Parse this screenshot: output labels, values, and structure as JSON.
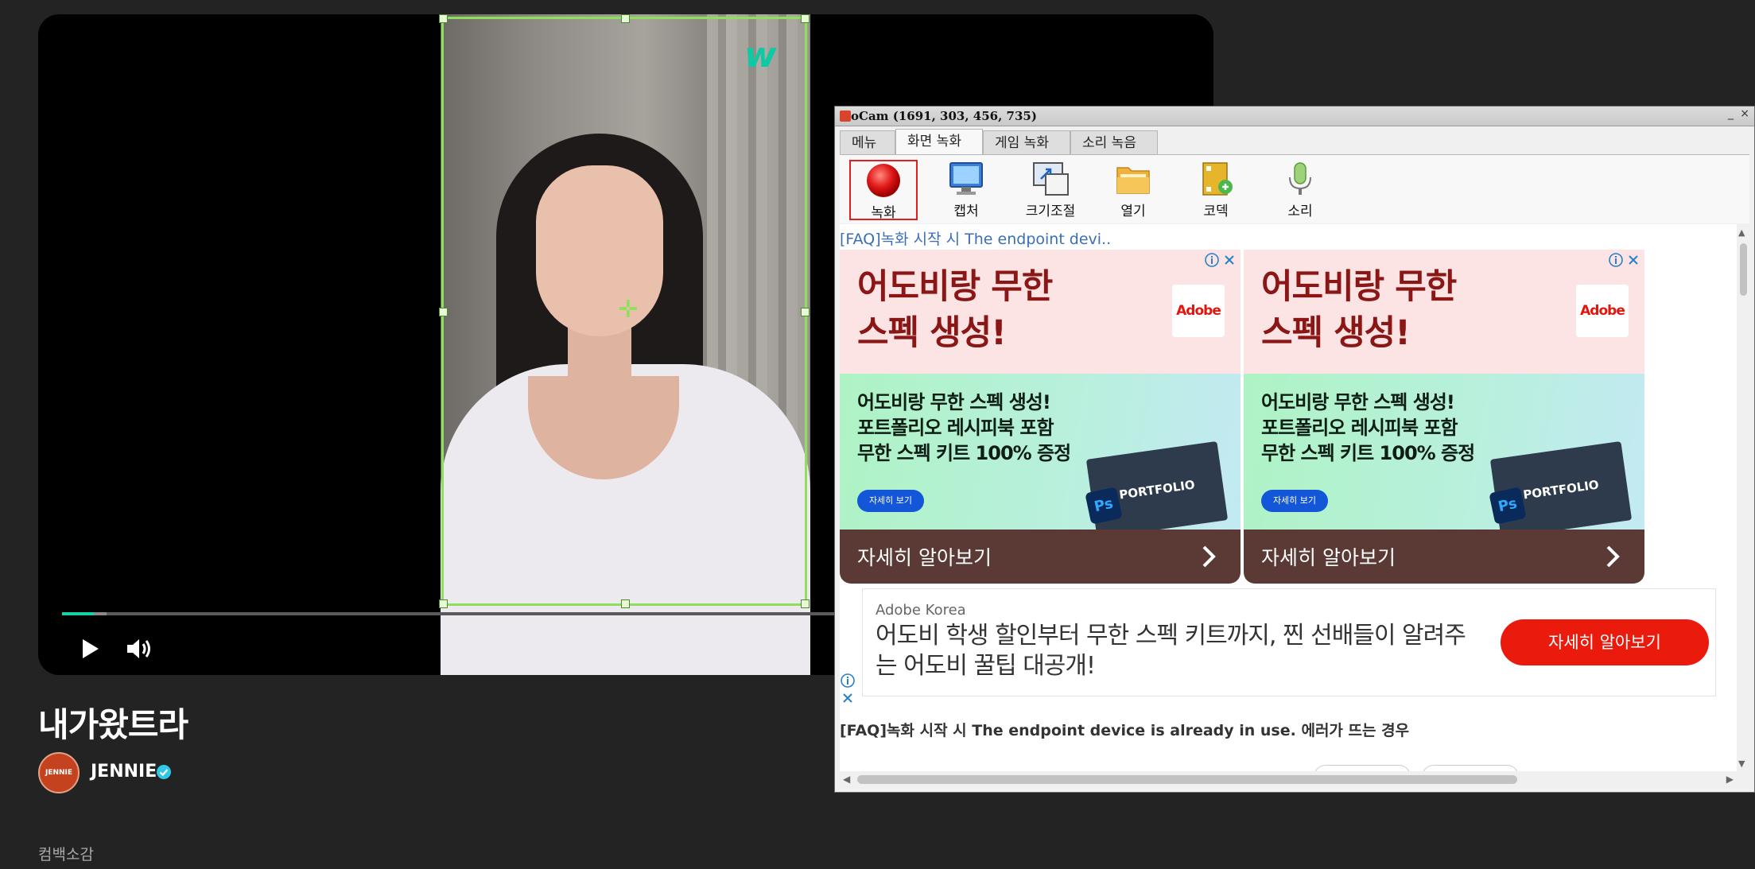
{
  "player": {
    "progress_fraction": 0.028,
    "play_icon": "play-icon",
    "volume_icon": "volume-icon",
    "watermark": "w"
  },
  "video": {
    "title": "내가왔트라",
    "artist": "JENNIE",
    "avatar_text": "JENNIE",
    "section_label": "컴백소감"
  },
  "ocam": {
    "title": "oCam (1691, 303, 456, 735)",
    "minimize": "_",
    "close": "×",
    "tabs": [
      {
        "label": "메뉴"
      },
      {
        "label": "화면 녹화",
        "active": true
      },
      {
        "label": "게임 녹화"
      },
      {
        "label": "소리 녹음"
      }
    ],
    "tools": [
      {
        "label": "녹화",
        "icon": "record-icon"
      },
      {
        "label": "캡처",
        "icon": "monitor-icon"
      },
      {
        "label": "크기조절",
        "icon": "resize-icon"
      },
      {
        "label": "열기",
        "icon": "folder-icon"
      },
      {
        "label": "코덱",
        "icon": "codec-icon"
      },
      {
        "label": "소리",
        "icon": "microphone-icon"
      }
    ],
    "faq_link": "[FAQ]녹화 시작 시 The endpoint devi..",
    "ads": [
      {
        "headline_line1": "어도비랑 무한",
        "headline_line2": "스펙 생성!",
        "logo": "Adobe",
        "body_line1": "어도비랑 무한 스펙 생성!",
        "body_line2": "포트폴리오 레시피북 포함",
        "body_line3": "무한 스펙 키트 100% 증정",
        "pill": "자세히 보기",
        "portfolio": "PORTFOLIO",
        "ps": "Ps",
        "cta": "자세히 알아보기"
      },
      {
        "headline_line1": "어도비랑 무한",
        "headline_line2": "스펙 생성!",
        "logo": "Adobe",
        "body_line1": "어도비랑 무한 스펙 생성!",
        "body_line2": "포트폴리오 레시피북 포함",
        "body_line3": "무한 스펙 키트 100% 증정",
        "pill": "자세히 보기",
        "portfolio": "PORTFOLIO",
        "ps": "Ps",
        "cta": "자세히 알아보기"
      }
    ],
    "native_ad": {
      "advertiser": "Adobe Korea",
      "text": "어도비 학생 할인부터 무한 스펙 키트까지, 찐 선배들이 알려주는 어도비 꿀팁 대공개!",
      "button": "자세히 알아보기"
    },
    "faq_heading": "[FAQ]녹화 시작 시 The endpoint device is already in use. 에러가 뜨는 경우"
  },
  "colors": {
    "accent_teal": "#17d1a8",
    "selection_green": "#8ee05c",
    "adobe_red": "#ea1a0c",
    "page_bg": "#232323"
  }
}
